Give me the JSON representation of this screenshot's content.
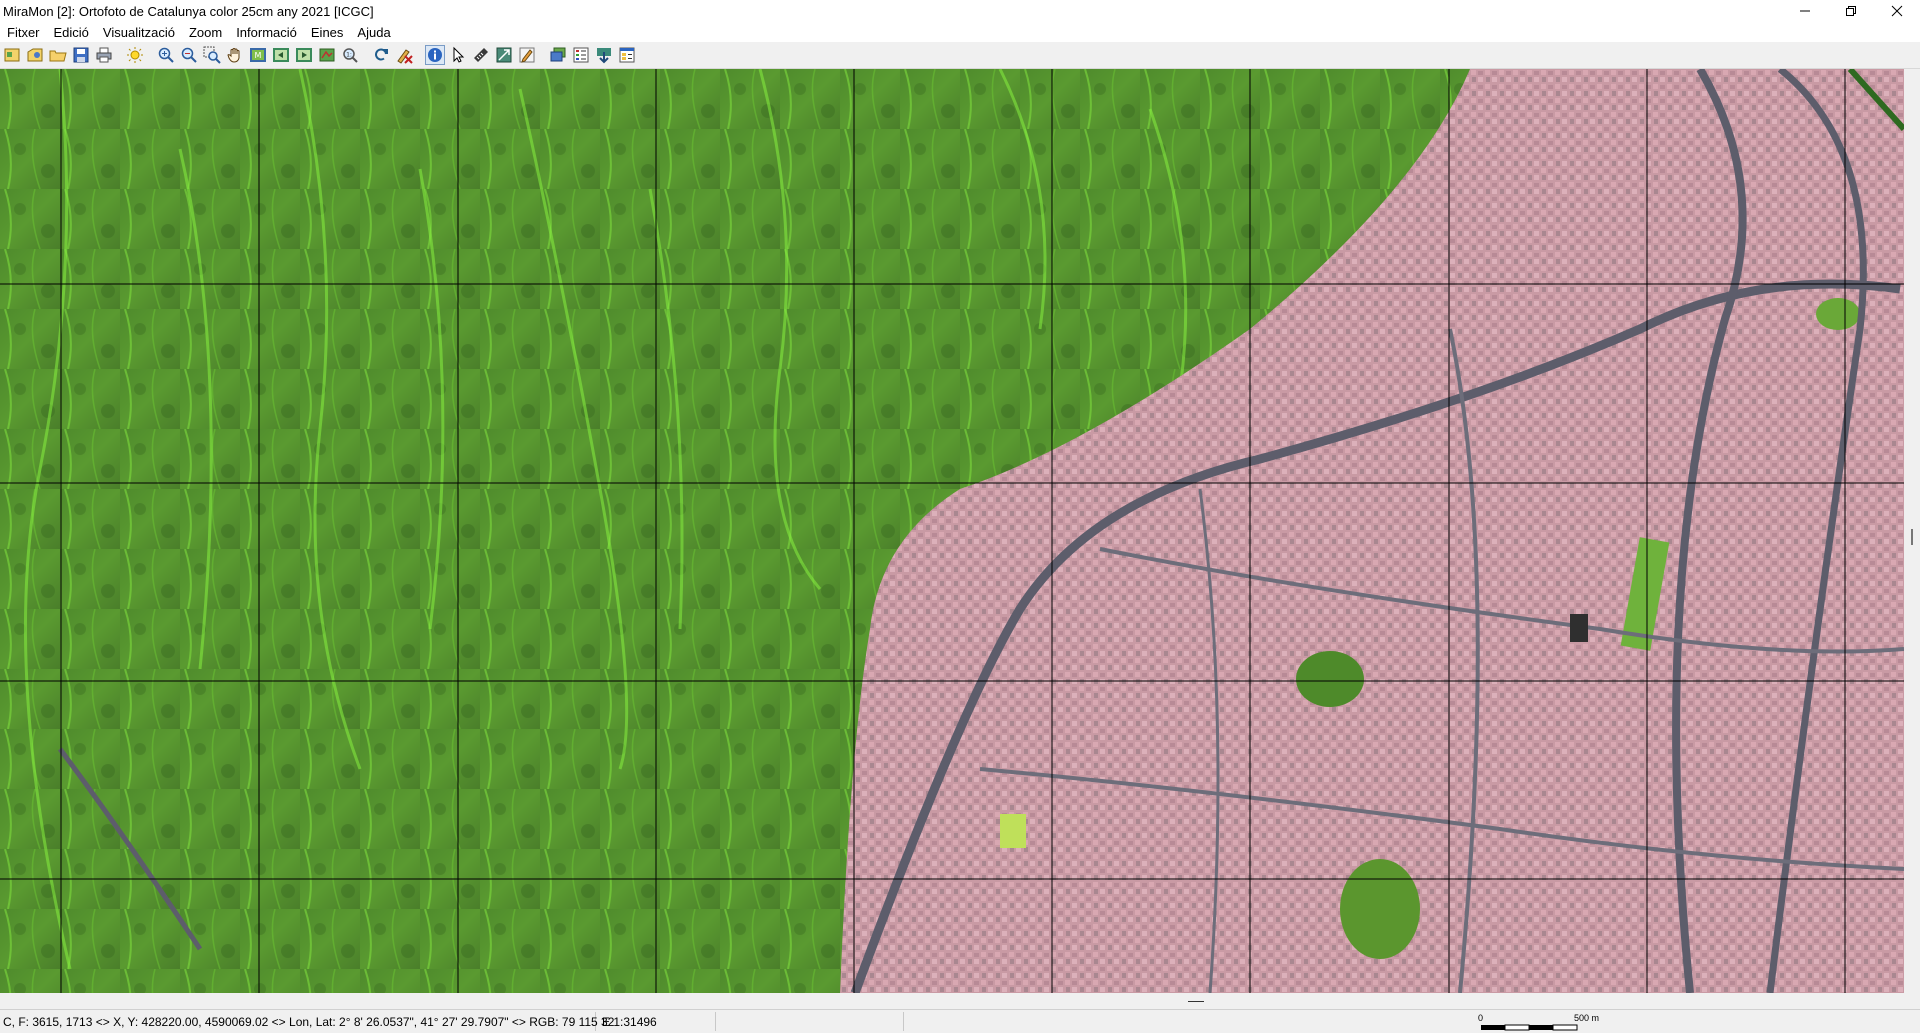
{
  "window": {
    "title": "MiraMon [2]:  Ortofoto de Catalunya color 25cm any 2021 [ICGC]",
    "controls": [
      "minimize",
      "maximize",
      "close"
    ]
  },
  "menu": [
    "Fitxer",
    "Edició",
    "Visualització",
    "Zoom",
    "Informació",
    "Eines",
    "Ajuda"
  ],
  "toolbar": {
    "buttons": [
      "open-map-icon",
      "open-layer-icon",
      "open-folder-icon",
      "save-icon",
      "print-icon",
      "sun-icon",
      "zoom-in-icon",
      "zoom-out-icon",
      "zoom-window-icon",
      "pan-hand-icon",
      "full-extent-icon",
      "zoom-previous-icon",
      "zoom-next-icon",
      "zoom-layer-icon",
      "zoom-scale-icon",
      "refresh-icon",
      "stop-draw-icon",
      "info-icon",
      "pointer-icon",
      "measure-icon",
      "georeference-icon",
      "edit-icon",
      "layers-icon",
      "legend-icon",
      "download-icon",
      "properties-icon"
    ]
  },
  "map": {
    "colors": {
      "grid": "#000000",
      "vegetation": "#4f8a2a",
      "urban": "#c89aa2",
      "road": "#5d5d6b"
    }
  },
  "status": {
    "coords": "C, F: 3615, 1713 <> X, Y: 428220.00, 4590069.02 <> Lon, Lat: 2° 8' 26.0537\", 41° 27' 29.7907\" <> RGB:  79 115 32",
    "scale": "E 1:31496",
    "scalebar_start": "0",
    "scalebar_end": "500 m"
  }
}
